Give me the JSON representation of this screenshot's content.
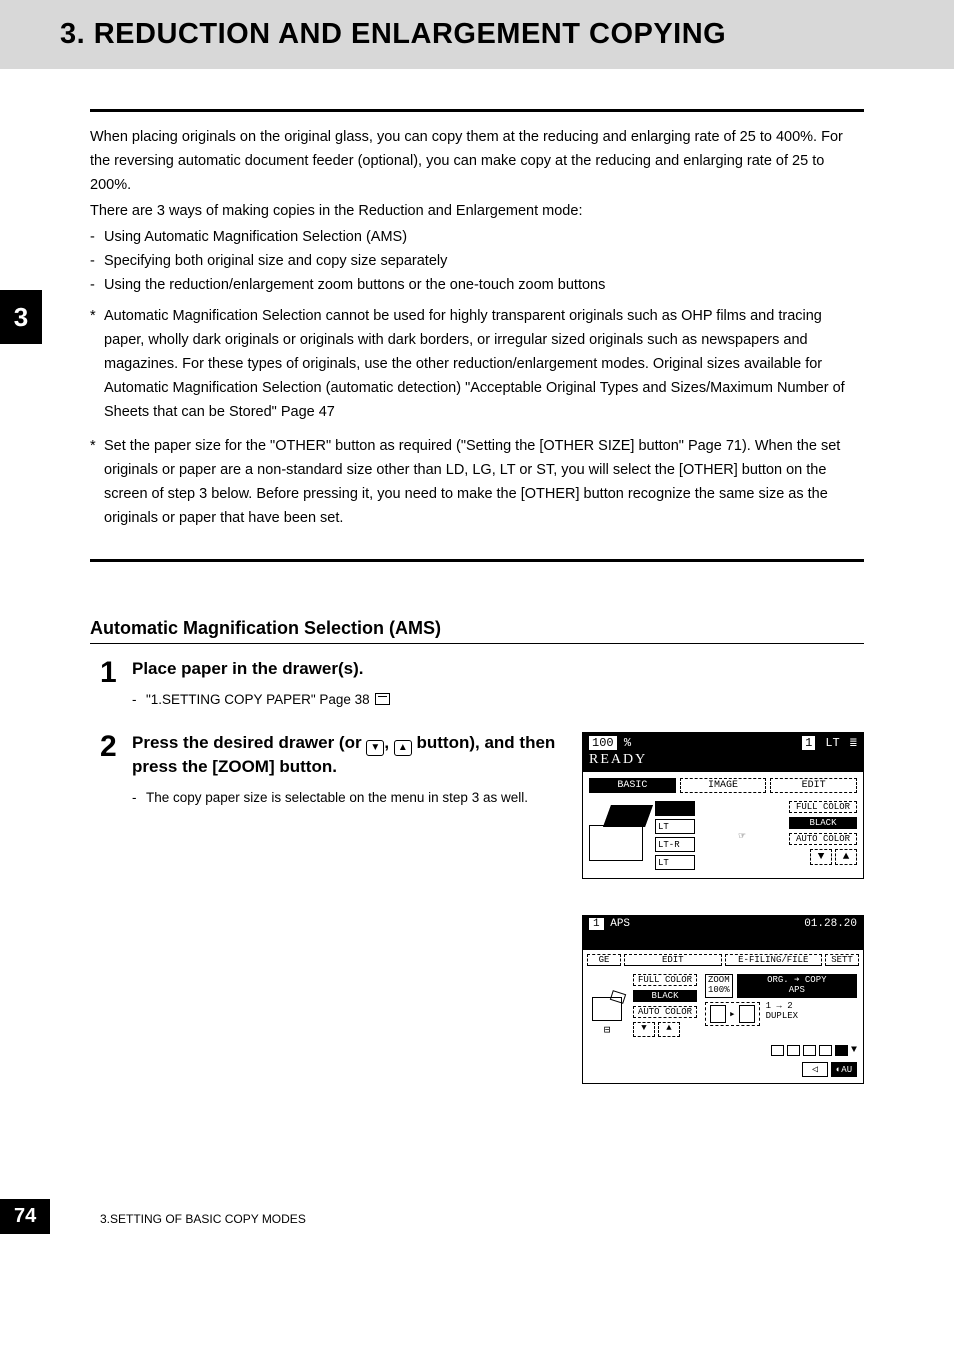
{
  "header": {
    "title": "3. REDUCTION AND ENLARGEMENT COPYING"
  },
  "tab_number": "3",
  "intro": {
    "p1": "When placing originals on the original glass, you can copy them at the reducing and enlarging rate of 25 to 400%. For the reversing automatic document feeder (optional), you can make copy at the reducing and enlarging rate of 25 to 200%.",
    "p2": "There are 3 ways of making copies in the Reduction and Enlargement mode:",
    "ways": [
      "Using Automatic Magnification Selection (AMS)",
      "Specifying both original size and copy size separately",
      "Using the reduction/enlargement zoom buttons or the one-touch zoom buttons"
    ],
    "notes": [
      "Automatic Magnification Selection cannot be used for highly transparent originals such as OHP films and tracing paper, wholly dark originals or originals with dark borders, or irregular sized originals such as newspapers and magazines. For these types of originals, use the other reduction/enlargement modes. Original sizes available for Automatic Magnification Selection (automatic detection) \"Acceptable Original Types and Sizes/Maximum Number of Sheets that can be Stored\"    Page 47",
      "Set the paper size for the \"OTHER\" button as required (\"Setting the [OTHER SIZE] button\"    Page 71). When the set originals or paper are a non-standard size other than LD, LG, LT or ST, you will select the [OTHER] button on the screen of step 3 below. Before pressing it, you need to make the [OTHER] button recognize the same size as the originals or paper that have been set."
    ]
  },
  "section": {
    "heading": "Automatic Magnification Selection (AMS)"
  },
  "steps": {
    "s1": {
      "num": "1",
      "title": "Place paper in the drawer(s).",
      "sub": "\"1.SETTING COPY PAPER\"    Page 38"
    },
    "s2": {
      "num": "2",
      "title_a": "Press the desired drawer (or ",
      "title_b": ", ",
      "title_c": " button), and then press the [ZOOM] button.",
      "sub": "The copy paper size is selectable on the menu in step 3 as well."
    }
  },
  "lcd1": {
    "zoom": "100",
    "pct": "%",
    "count": "1",
    "paper": "LT",
    "ready": "READY",
    "tabs": [
      "BASIC",
      "IMAGE",
      "EDIT"
    ],
    "trays": [
      "",
      "LT",
      "LT-R",
      "LT"
    ],
    "opts": [
      "FULL COLOR",
      "BLACK",
      "AUTO COLOR"
    ]
  },
  "lcd2": {
    "count": "1",
    "mode": "APS",
    "time": "01.28.20",
    "tabs": [
      "GE",
      "EDIT",
      "E-FILING/FILE",
      "SETT"
    ],
    "colors": [
      "FULL COLOR",
      "BLACK",
      "AUTO COLOR"
    ],
    "zoom_label": "ZOOM",
    "zoom_val": "100%",
    "orig_label": "ORG. ➔ COPY",
    "orig_val": "APS",
    "duplex_label": "1 → 2",
    "duplex_sub": "DUPLEX",
    "au": "AU"
  },
  "footer": {
    "page": "74",
    "text": "3.SETTING OF BASIC COPY MODES"
  }
}
